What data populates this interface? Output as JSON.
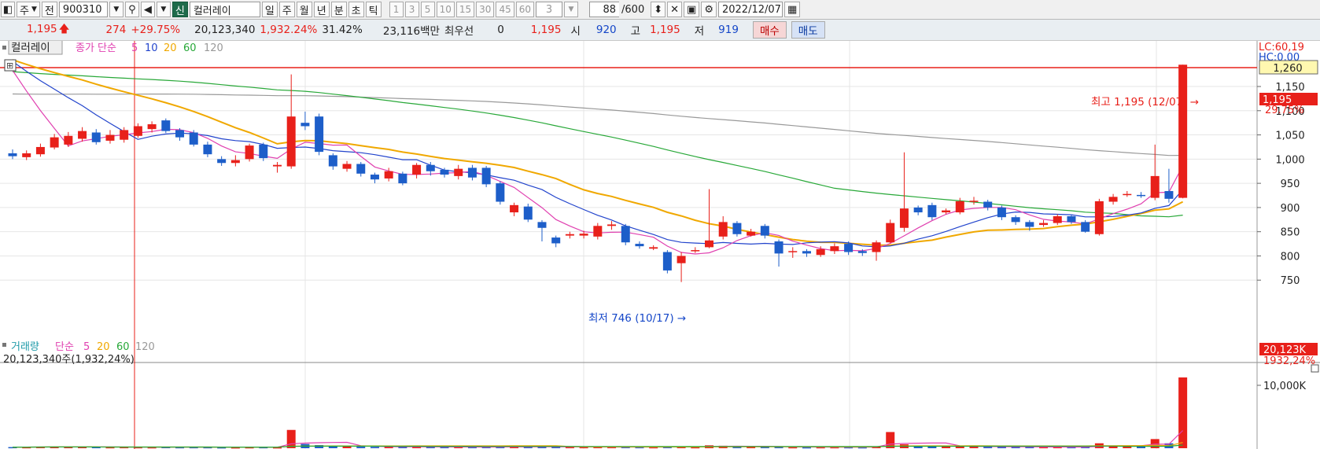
{
  "toolbar": {
    "period_type": "주",
    "scope": "전",
    "code": "900310",
    "badge": "신",
    "name": "컬러레이",
    "intervals": [
      {
        "label": "일",
        "active": true
      },
      {
        "label": "주",
        "active": false
      },
      {
        "label": "월",
        "active": false
      },
      {
        "label": "년",
        "active": false
      },
      {
        "label": "분",
        "active": false
      },
      {
        "label": "초",
        "active": false
      },
      {
        "label": "틱",
        "active": false
      }
    ],
    "minute_steps": [
      "1",
      "3",
      "5",
      "10",
      "15",
      "30",
      "45",
      "60"
    ],
    "step_value": "3",
    "count": "88",
    "count_total": "/600",
    "date": "2022/12/07"
  },
  "quote": {
    "price": "1,195",
    "arrow": "🡅",
    "change": "274",
    "change_pct": "+29.75%",
    "volume": "20,123,340",
    "volume_pct": "1,932.24%",
    "turnover_pct": "31.42%",
    "amount": "23,116백만",
    "priority_label": "최우선",
    "priority_value": "0",
    "priority_price": "1,195",
    "open_label": "시",
    "open": "920",
    "high_label": "고",
    "high": "1,195",
    "low_label": "저",
    "low": "919",
    "buy_label": "매수",
    "sell_label": "매도"
  },
  "price_panel": {
    "legend_name": "컬러레이",
    "legend_ma_label": "종가 단순",
    "ma_periods": [
      "5",
      "10",
      "20",
      "60",
      "120"
    ],
    "upper_limit_text": "LC:60,19",
    "upper_limit_text2": "HC:0,00",
    "line_label": "1,260",
    "current_label": "1,195",
    "current_pct": "29.75%",
    "high_note": "최고 1,195 (12/07) →",
    "low_note": "최저 746 (10/17) →",
    "y_ticks": [
      "1,150",
      "1,100",
      "1,050",
      "1,000",
      "950",
      "900",
      "850",
      "800",
      "750"
    ]
  },
  "volume_panel": {
    "legend_name": "거래량",
    "legend_ma_label": "단순",
    "ma_periods": [
      "5",
      "20",
      "60",
      "120"
    ],
    "readout": "20,123,340주(1,932,24%)",
    "current_label": "20,123K",
    "current_pct": "1932,24%",
    "y_tick": "10,000K"
  },
  "chart_data": {
    "type": "candlestick",
    "y_range": [
      720,
      1310
    ],
    "reference_line": 1260,
    "colors": {
      "up": "#e8201a",
      "down": "#1d5ec9",
      "ma5": "#e040b0",
      "ma10": "#2244cc",
      "ma20": "#f0a800",
      "ma60": "#28a838",
      "ma120": "#999999",
      "ref": "#e8201a"
    },
    "candles": [
      [
        1012,
        1006,
        1020,
        1000,
        320
      ],
      [
        1004,
        1012,
        1018,
        998,
        300
      ],
      [
        1010,
        1025,
        1032,
        1005,
        360
      ],
      [
        1024,
        1045,
        1052,
        1020,
        420
      ],
      [
        1030,
        1048,
        1056,
        1025,
        380
      ],
      [
        1042,
        1058,
        1066,
        1036,
        350
      ],
      [
        1055,
        1035,
        1062,
        1030,
        330
      ],
      [
        1038,
        1050,
        1060,
        1032,
        300
      ],
      [
        1040,
        1060,
        1066,
        1034,
        320
      ],
      [
        1048,
        1068,
        1074,
        1044,
        300
      ],
      [
        1062,
        1072,
        1078,
        1055,
        280
      ],
      [
        1080,
        1058,
        1084,
        1054,
        330
      ],
      [
        1060,
        1045,
        1064,
        1038,
        300
      ],
      [
        1055,
        1030,
        1060,
        1026,
        310
      ],
      [
        1030,
        1010,
        1036,
        1004,
        300
      ],
      [
        1000,
        992,
        1006,
        986,
        260
      ],
      [
        992,
        998,
        1008,
        985,
        250
      ],
      [
        1000,
        1028,
        1032,
        995,
        280
      ],
      [
        1030,
        1002,
        1034,
        996,
        300
      ],
      [
        985,
        988,
        994,
        972,
        260
      ],
      [
        985,
        1088,
        1175,
        980,
        5200
      ],
      [
        1075,
        1068,
        1098,
        1060,
        1200
      ],
      [
        1088,
        1015,
        1094,
        1008,
        900
      ],
      [
        1008,
        985,
        1012,
        978,
        600
      ],
      [
        980,
        990,
        996,
        974,
        450
      ],
      [
        990,
        970,
        994,
        964,
        420
      ],
      [
        968,
        958,
        972,
        950,
        380
      ],
      [
        960,
        975,
        982,
        954,
        400
      ],
      [
        970,
        950,
        974,
        946,
        360
      ],
      [
        968,
        988,
        992,
        960,
        420
      ],
      [
        988,
        975,
        994,
        966,
        360
      ],
      [
        978,
        968,
        982,
        962,
        330
      ],
      [
        965,
        980,
        988,
        958,
        340
      ],
      [
        982,
        962,
        988,
        956,
        330
      ],
      [
        982,
        948,
        986,
        942,
        340
      ],
      [
        950,
        912,
        954,
        906,
        450
      ],
      [
        890,
        905,
        910,
        882,
        400
      ],
      [
        902,
        875,
        908,
        870,
        420
      ],
      [
        870,
        858,
        874,
        830,
        400
      ],
      [
        838,
        826,
        842,
        818,
        380
      ],
      [
        842,
        845,
        850,
        836,
        330
      ],
      [
        842,
        846,
        852,
        836,
        320
      ],
      [
        840,
        862,
        868,
        834,
        360
      ],
      [
        862,
        865,
        872,
        854,
        330
      ],
      [
        862,
        828,
        866,
        822,
        350
      ],
      [
        825,
        820,
        830,
        815,
        320
      ],
      [
        815,
        818,
        822,
        812,
        300
      ],
      [
        808,
        770,
        812,
        764,
        420
      ],
      [
        785,
        800,
        808,
        746,
        460
      ],
      [
        810,
        812,
        818,
        806,
        300
      ],
      [
        818,
        832,
        938,
        816,
        820
      ],
      [
        840,
        870,
        882,
        834,
        700
      ],
      [
        868,
        845,
        872,
        840,
        460
      ],
      [
        842,
        850,
        856,
        840,
        380
      ],
      [
        862,
        842,
        866,
        836,
        360
      ],
      [
        830,
        805,
        834,
        778,
        420
      ],
      [
        808,
        810,
        818,
        796,
        300
      ],
      [
        810,
        805,
        814,
        798,
        280
      ],
      [
        802,
        814,
        820,
        798,
        300
      ],
      [
        810,
        820,
        826,
        804,
        300
      ],
      [
        825,
        808,
        830,
        802,
        300
      ],
      [
        810,
        806,
        814,
        800,
        280
      ],
      [
        808,
        828,
        832,
        790,
        480
      ],
      [
        828,
        868,
        875,
        826,
        4600
      ],
      [
        858,
        898,
        1014,
        850,
        1100
      ],
      [
        900,
        890,
        904,
        884,
        650
      ],
      [
        905,
        880,
        910,
        874,
        560
      ],
      [
        890,
        894,
        898,
        886,
        480
      ],
      [
        890,
        913,
        920,
        886,
        520
      ],
      [
        912,
        914,
        922,
        906,
        460
      ],
      [
        912,
        900,
        916,
        894,
        420
      ],
      [
        900,
        880,
        904,
        874,
        400
      ],
      [
        880,
        870,
        884,
        864,
        360
      ],
      [
        870,
        860,
        874,
        852,
        340
      ],
      [
        864,
        868,
        874,
        860,
        320
      ],
      [
        868,
        882,
        886,
        864,
        330
      ],
      [
        882,
        870,
        886,
        866,
        320
      ],
      [
        870,
        850,
        874,
        848,
        360
      ],
      [
        845,
        913,
        918,
        842,
        1400
      ],
      [
        912,
        922,
        928,
        906,
        700
      ],
      [
        928,
        928,
        934,
        922,
        520
      ],
      [
        926,
        925,
        932,
        920,
        460
      ],
      [
        920,
        965,
        1030,
        915,
        2600
      ],
      [
        934,
        918,
        980,
        910,
        1400
      ],
      [
        920,
        1195,
        1195,
        919,
        20123
      ]
    ]
  }
}
